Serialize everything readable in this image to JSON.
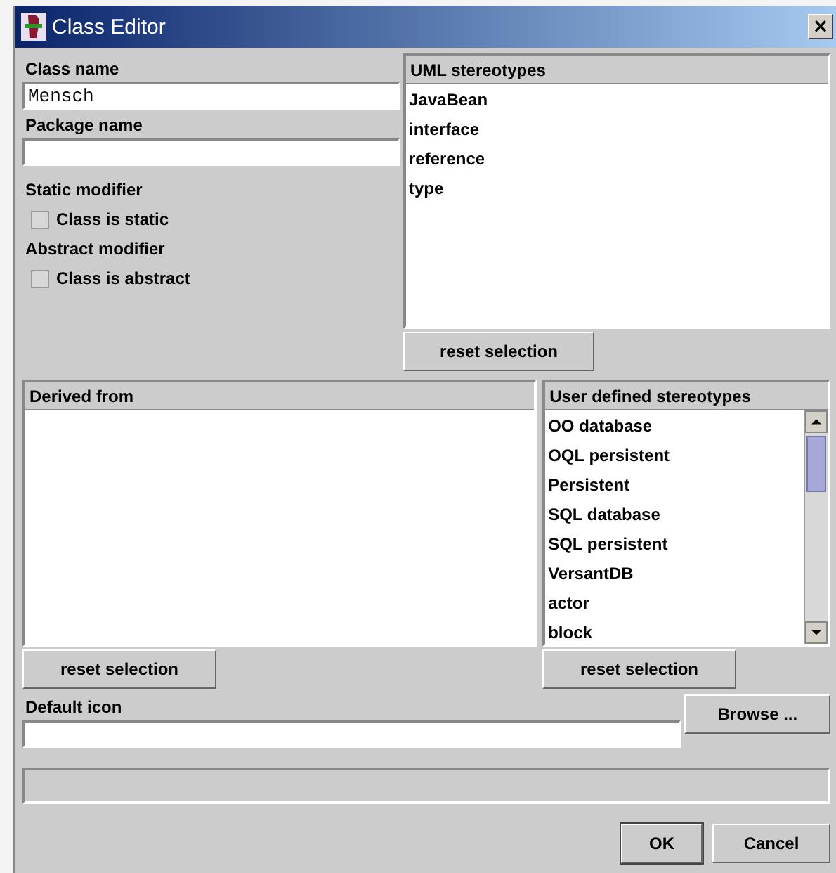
{
  "window": {
    "title": "Class Editor",
    "close": "×"
  },
  "class_name": {
    "label": "Class name",
    "value": "Mensch"
  },
  "package_name": {
    "label": "Package name"
  },
  "static_modifier": {
    "label": "Static modifier",
    "checkbox": {
      "label": "Class is static",
      "checked": false
    }
  },
  "abstract_modifier": {
    "label": "Abstract modifier",
    "checkbox": {
      "label": "Class is abstract",
      "checked": false
    }
  },
  "uml_stereotypes": {
    "title": "UML stereotypes",
    "items": [
      "JavaBean",
      "interface",
      "reference",
      "type"
    ],
    "reset": "reset selection"
  },
  "derived_from": {
    "title": "Derived from",
    "reset": "reset selection"
  },
  "user_defined_stereotypes": {
    "title": "User defined stereotypes",
    "items": [
      "OO database",
      "OQL persistent",
      "Persistent",
      "SQL database",
      "SQL persistent",
      "VersantDB",
      "actor",
      "block"
    ],
    "reset": "reset selection"
  },
  "default_icon": {
    "label": "Default icon",
    "browse": "Browse ..."
  },
  "buttons": [
    {
      "label": "OK",
      "default": true
    },
    {
      "label": "Cancel",
      "default": false
    }
  ]
}
